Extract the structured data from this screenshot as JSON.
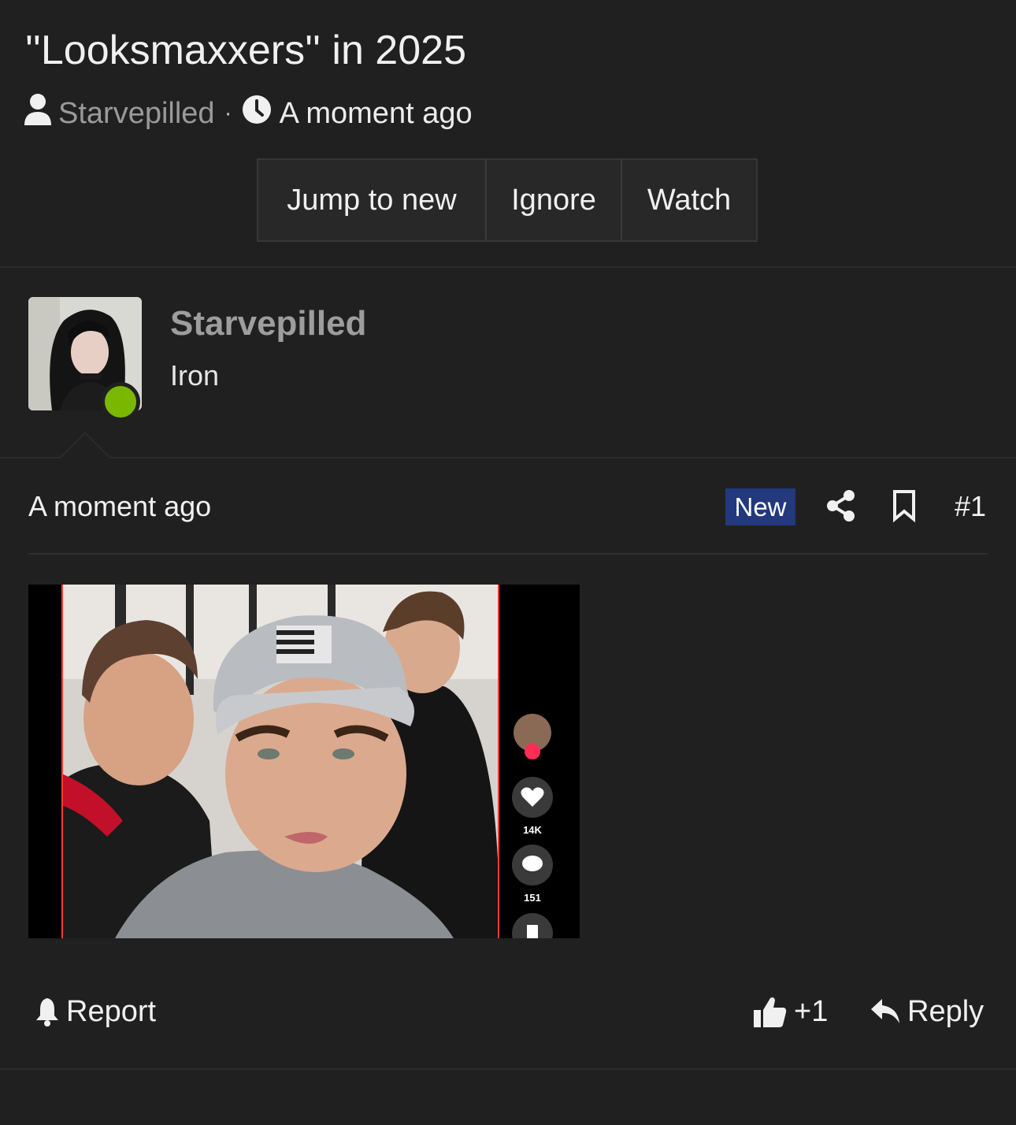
{
  "thread": {
    "title": "''Looksmaxxers'' in 2025",
    "author": "Starvepilled",
    "separator": "·",
    "time": "A moment ago",
    "buttons": {
      "jump": "Jump to new",
      "ignore": "Ignore",
      "watch": "Watch"
    }
  },
  "user": {
    "name": "Starvepilled",
    "title": "Iron",
    "online_color": "#7ab800"
  },
  "post": {
    "time": "A moment ago",
    "new_badge": "New",
    "number": "#1",
    "icons": [
      "share-icon",
      "bookmark-icon"
    ],
    "image": {
      "overlay": {
        "likes": "14K",
        "comments": "151"
      }
    }
  },
  "actions": {
    "report": "Report",
    "like": "+1",
    "reply": "Reply"
  },
  "colors": {
    "background": "#202021",
    "badge": "#22397e",
    "muted_text": "#9d9d9d"
  }
}
